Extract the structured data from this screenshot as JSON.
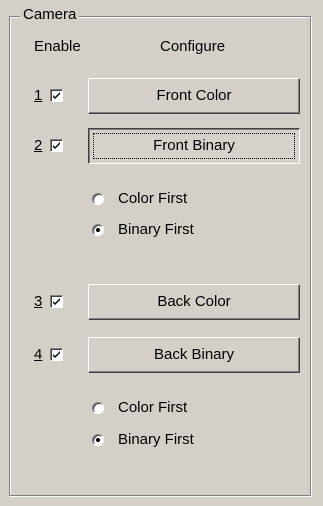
{
  "group": {
    "title": "Camera"
  },
  "headers": {
    "enable": "Enable",
    "configure": "Configure"
  },
  "cameras": [
    {
      "number": "1",
      "enabled": true,
      "button_label": "Front Color"
    },
    {
      "number": "2",
      "enabled": true,
      "button_label": "Front Binary",
      "focused": true
    },
    {
      "number": "3",
      "enabled": true,
      "button_label": "Back Color"
    },
    {
      "number": "4",
      "enabled": true,
      "button_label": "Back Binary"
    }
  ],
  "front_order": {
    "options": [
      "Color First",
      "Binary First"
    ],
    "selected": "Binary First"
  },
  "back_order": {
    "options": [
      "Color First",
      "Binary First"
    ],
    "selected": "Binary First"
  },
  "colors": {
    "face": "#d4d0c8",
    "highlight": "#ffffff",
    "shadow": "#808080",
    "dark_shadow": "#404040"
  }
}
